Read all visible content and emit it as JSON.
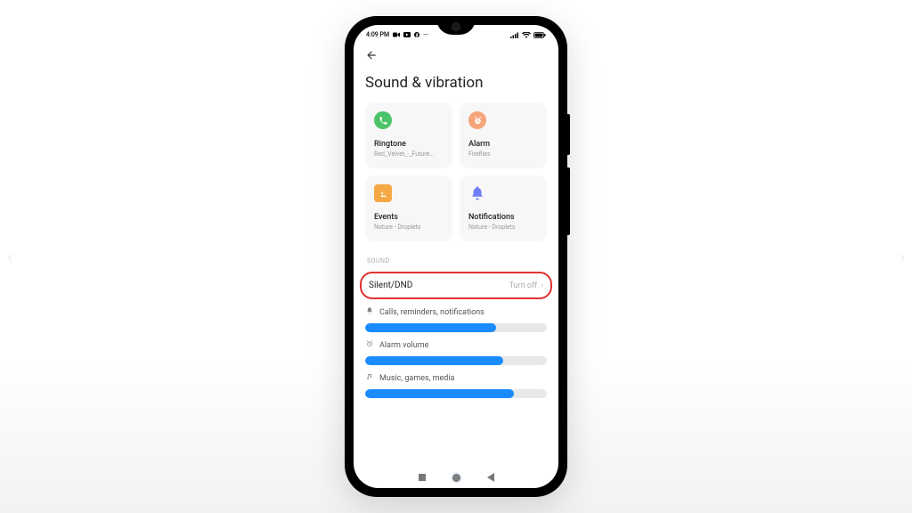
{
  "status": {
    "time": "4:09 PM",
    "dots": "···"
  },
  "page": {
    "title": "Sound & vibration"
  },
  "cards": {
    "ringtone": {
      "title": "Ringtone",
      "sub": "Red_Velvet_-_Future…"
    },
    "alarm": {
      "title": "Alarm",
      "sub": "Fireflies"
    },
    "events": {
      "title": "Events",
      "sub": "Nature - Droplets"
    },
    "notifications": {
      "title": "Notifications",
      "sub": "Nature - Droplets"
    }
  },
  "section": {
    "sound_label": "SOUND"
  },
  "silent": {
    "label": "Silent/DND",
    "value": "Turn off"
  },
  "sliders": {
    "calls": {
      "label": "Calls, reminders, notifications",
      "pct": 72
    },
    "alarm": {
      "label": "Alarm volume",
      "pct": 76
    },
    "media": {
      "label": "Music, games, media",
      "pct": 82
    }
  }
}
